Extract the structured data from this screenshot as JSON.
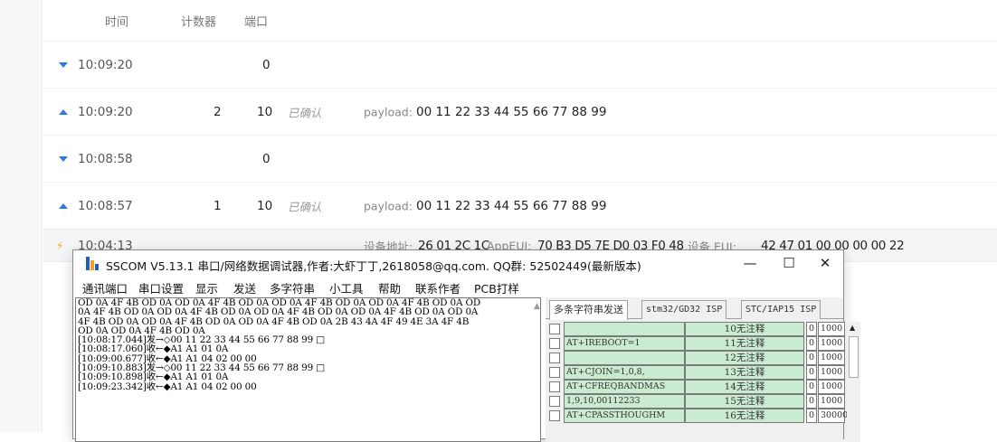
{
  "table": {
    "headers": {
      "time": "时间",
      "counter": "计数器",
      "port": "端口"
    },
    "rows": [
      {
        "kind": "down",
        "time": "10:09:20",
        "counter": "",
        "port": "0",
        "status": "",
        "payload_label": "",
        "payload": ""
      },
      {
        "kind": "up",
        "time": "10:09:20",
        "counter": "2",
        "port": "10",
        "status": "已确认",
        "payload_label": "payload:",
        "payload": "00 11 22 33 44 55 66 77 88 99"
      },
      {
        "kind": "down",
        "time": "10:08:58",
        "counter": "",
        "port": "0",
        "status": "",
        "payload_label": "",
        "payload": ""
      },
      {
        "kind": "up",
        "time": "10:08:57",
        "counter": "1",
        "port": "10",
        "status": "已确认",
        "payload_label": "payload:",
        "payload": "00 11 22 33 44 55 66 77 88 99"
      }
    ],
    "join_row": {
      "time": "10:04:13",
      "dev_addr_label": "设备地址:",
      "dev_addr": "26 01 2C 1C",
      "app_eui_label": "AppEUI:",
      "app_eui": "70 B3 D5 7E D0 03 F0 48",
      "dev_eui_label": "设备 EUI:",
      "dev_eui": "42 47 01 00 00 00 00 22"
    }
  },
  "sscom": {
    "title": "SSCOM V5.13.1 串口/网络数据调试器,作者:大虾丁丁,2618058@qq.com. QQ群:  52502449(最新版本)",
    "window_buttons": {
      "minimize": "—",
      "maximize": "☐",
      "close": "✕"
    },
    "menu": [
      "通讯端口",
      "串口设置",
      "显示",
      "发送",
      "多字符串",
      "小工具",
      "帮助",
      "联系作者",
      "PCB打样"
    ],
    "log_lines": [
      "OD 0A 4F 4B OD 0A OD 0A 4F 4B OD 0A OD 0A 4F 4B OD 0A OD 0A 4F 4B OD 0A OD",
      "0A 4F 4B OD 0A OD 0A 4F 4B OD 0A OD 0A 4F 4B OD 0A OD 0A 4F 4B OD 0A OD 0A",
      "4F 4B OD 0A OD 0A 4F 4B OD 0A OD 0A 4F 4B OD 0A 2B 43 4A 4F 49 4E 3A 4F 4B",
      "OD 0A OD 0A 4F 4B OD 0A",
      "[10:08:17.044]发→◇00 11 22 33 44 55 66 77 88 99 □",
      "[10:08:17.060]收←◆A1 A1 01 0A",
      "[10:09:00.677]收←◆A1 A1 04 02 00 00",
      "[10:09:10.883]发→◇00 11 22 33 44 55 66 77 88 99 □",
      "[10:09:10.898]收←◆A1 A1 01 0A",
      "[10:09:23.342]收←◆A1 A1 04 02 00 00"
    ],
    "tabs": [
      "多条字符串发送",
      "stm32/GD32 ISP",
      "STC/IAP15 ISP"
    ],
    "rows": [
      {
        "cmd": "",
        "note": "10无注释",
        "n": "0",
        "ms": "1000"
      },
      {
        "cmd": "AT+IREBOOT=1",
        "note": "11无注释",
        "n": "0",
        "ms": "1000"
      },
      {
        "cmd": "",
        "note": "12无注释",
        "n": "0",
        "ms": "1000"
      },
      {
        "cmd": "AT+CJOIN=1,0,8,",
        "note": "13无注释",
        "n": "0",
        "ms": "1000"
      },
      {
        "cmd": "AT+CFREQBANDMAS",
        "note": "14无注释",
        "n": "0",
        "ms": "1000"
      },
      {
        "cmd": "1,9,10,00112233",
        "note": "15无注释",
        "n": "0",
        "ms": "1000"
      },
      {
        "cmd": "AT+CPASSTHOUGHM",
        "note": "16无注释",
        "n": "0",
        "ms": "30000"
      }
    ]
  }
}
